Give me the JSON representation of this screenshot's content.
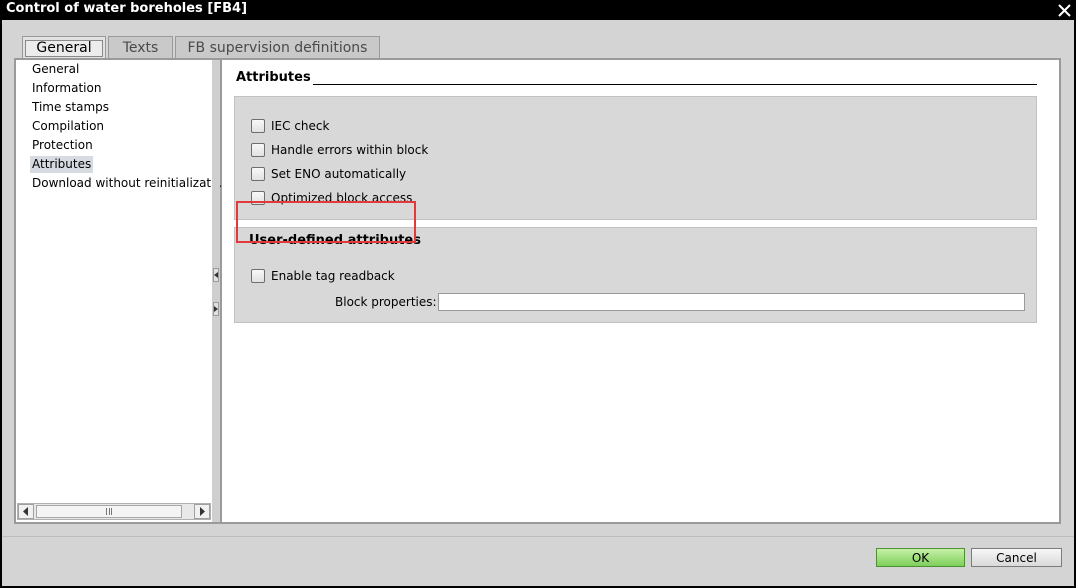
{
  "window": {
    "title": "Control of water boreholes [FB4]"
  },
  "tabs": [
    {
      "label": "General"
    },
    {
      "label": "Texts"
    },
    {
      "label": "FB supervision definitions"
    }
  ],
  "nav": {
    "items": [
      {
        "label": "General"
      },
      {
        "label": "Information"
      },
      {
        "label": "Time stamps"
      },
      {
        "label": "Compilation"
      },
      {
        "label": "Protection"
      },
      {
        "label": "Attributes"
      },
      {
        "label": "Download without reinitializati..."
      }
    ],
    "selected": "Attributes"
  },
  "attributes": {
    "title": "Attributes",
    "options": [
      {
        "label": "IEC check",
        "checked": false
      },
      {
        "label": "Handle errors within block",
        "checked": false
      },
      {
        "label": "Set ENO automatically",
        "checked": false
      },
      {
        "label": "Optimized block access",
        "checked": false
      }
    ]
  },
  "user_attributes": {
    "title": "User-defined attributes",
    "enable_tag_readback": {
      "label": "Enable tag readback",
      "checked": false
    },
    "block_properties_label": "Block properties:",
    "block_properties_value": ""
  },
  "footer": {
    "ok_label": "OK",
    "cancel_label": "Cancel"
  },
  "colors": {
    "highlight": "#e23a3a",
    "ok_button": "#7dcf5b",
    "selected_nav": "#d6dbe2"
  }
}
